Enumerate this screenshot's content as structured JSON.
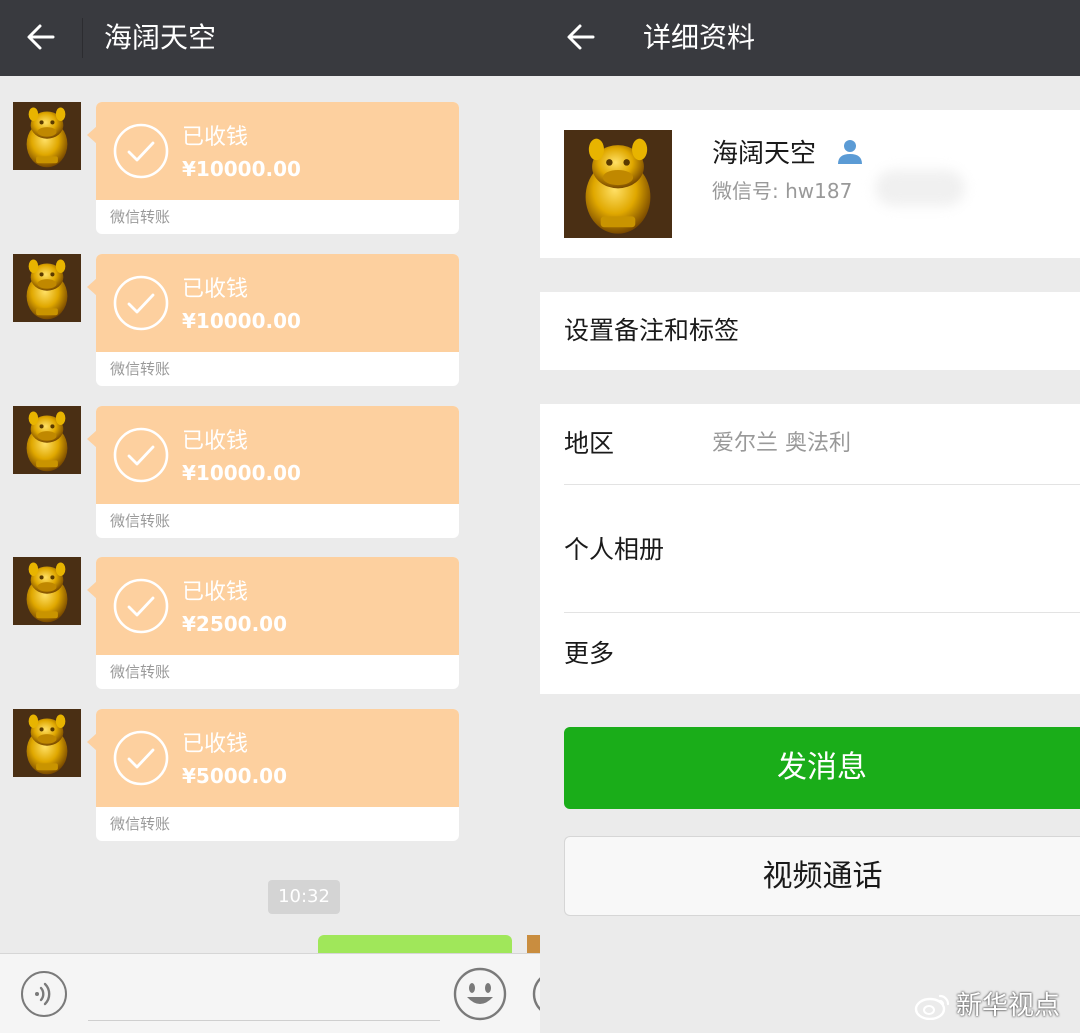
{
  "chat": {
    "title": "海阔天空",
    "messages": [
      {
        "status": "已收钱",
        "amount": "¥10000.00",
        "footer": "微信转账"
      },
      {
        "status": "已收钱",
        "amount": "¥10000.00",
        "footer": "微信转账"
      },
      {
        "status": "已收钱",
        "amount": "¥10000.00",
        "footer": "微信转账"
      },
      {
        "status": "已收钱",
        "amount": "¥2500.00",
        "footer": "微信转账"
      },
      {
        "status": "已收钱",
        "amount": "¥5000.00",
        "footer": "微信转账"
      }
    ],
    "timestamp": "10:32"
  },
  "profile": {
    "title": "详细资料",
    "name": "海阔天空",
    "wechat_id": "微信号: hw187",
    "rows": {
      "remark": "设置备注和标签",
      "region_label": "地区",
      "region_value": "爱尔兰  奥法利",
      "album": "个人相册",
      "more": "更多"
    },
    "send_message": "发消息",
    "video_call": "视频通话"
  },
  "watermark": "新华视点",
  "colors": {
    "topbar": "#393a3f",
    "transfer_bubble": "#fdd09f",
    "wechat_green": "#1aad19",
    "self_bubble": "#a0e75a"
  }
}
